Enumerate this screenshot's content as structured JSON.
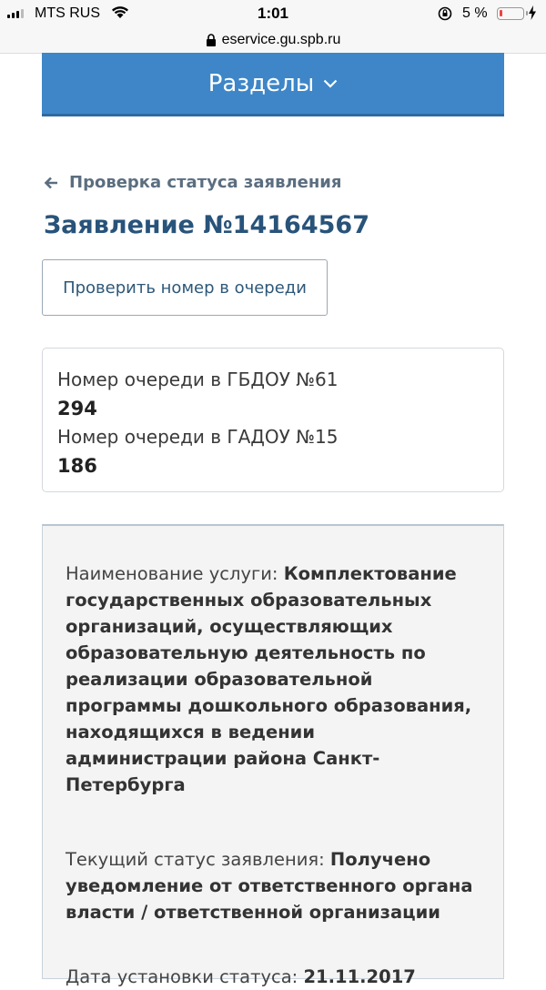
{
  "status_bar": {
    "carrier": "MTS RUS",
    "time": "1:01",
    "battery_percent": "5 %",
    "battery_level": 0.05
  },
  "url_bar": {
    "url": "eservice.gu.spb.ru"
  },
  "nav": {
    "sections_label": "Разделы"
  },
  "back_link": {
    "label": "Проверка статуса заявления"
  },
  "application": {
    "title": "Заявление №14164567"
  },
  "queue_button": {
    "label": "Проверить номер в очереди"
  },
  "queue_info": [
    {
      "label": "Номер очереди в ГБДОУ №61",
      "value": "294"
    },
    {
      "label": "Номер очереди в ГАДОУ №15",
      "value": "186"
    }
  ],
  "details": {
    "service_label": "Наименование услуги:",
    "service_value": "Комплектование государственных образовательных организаций, осуществляющих образовательную деятельность по реализации образовательной программы дошкольного образования, находящихся в ведении администрации района Санкт-Петербурга",
    "status_label": "Текущий статус заявления:",
    "status_value": "Получено уведомление от ответственного органа власти / ответственной организации",
    "date_label": "Дата установки статуса:",
    "date_value": "21.11.2017"
  }
}
